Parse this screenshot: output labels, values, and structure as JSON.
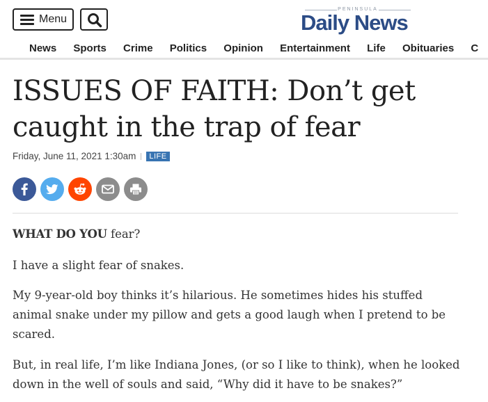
{
  "header": {
    "menu_label": "Menu",
    "logo_top": "PENINSULA",
    "logo_main": "Daily News"
  },
  "nav": {
    "items": [
      "News",
      "Sports",
      "Crime",
      "Politics",
      "Opinion",
      "Entertainment",
      "Life",
      "Obituaries",
      "C"
    ]
  },
  "article": {
    "title": "ISSUES OF FAITH: Don’t get caught in the trap of fear",
    "date": "Friday, June 11, 2021 1:30am",
    "category": "LIFE",
    "lead_bold": "WHAT DO YOU",
    "lead_rest": " fear?",
    "paragraphs": [
      "I have a slight fear of snakes.",
      "My 9-year-old boy thinks it’s hilarious. He sometimes hides his stuffed animal snake under my pillow and gets a good laugh when I pretend to be scared.",
      "But, in real life, I’m like Indiana Jones, (or so I like to think), when he looked down in the well of souls and said, “Why did it have to be snakes?”"
    ]
  },
  "share": {
    "icons": [
      "facebook-icon",
      "twitter-icon",
      "reddit-icon",
      "email-icon",
      "print-icon"
    ],
    "colors": {
      "facebook": "#3b5998",
      "twitter": "#55acee",
      "reddit": "#ff4500",
      "email": "#8c8c8c",
      "print": "#8c8c8c"
    }
  },
  "colors": {
    "brand": "#2c4c86",
    "badge": "#3874b2",
    "text": "#222222"
  }
}
